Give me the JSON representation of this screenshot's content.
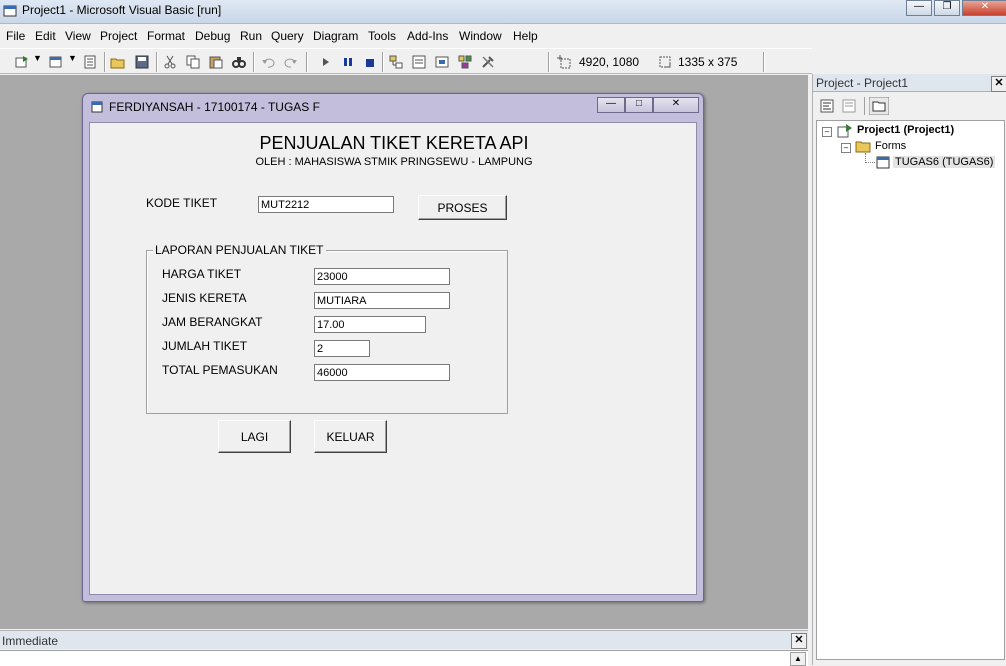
{
  "window": {
    "title": "Project1 - Microsoft Visual Basic [run]"
  },
  "menu": [
    "File",
    "Edit",
    "View",
    "Project",
    "Format",
    "Debug",
    "Run",
    "Query",
    "Diagram",
    "Tools",
    "Add-Ins",
    "Window",
    "Help"
  ],
  "toolbar": {
    "position": "4920, 1080",
    "size": "1335 x 375"
  },
  "form": {
    "title": "FERDIYANSAH - 17100174 - TUGAS F",
    "heading": "PENJUALAN TIKET KERETA API",
    "subheading": "OLEH : MAHASISWA STMIK PRINGSEWU - LAMPUNG",
    "kode_label": "KODE TIKET",
    "kode_value": "MUT2212",
    "proses_label": "PROSES",
    "frame_caption": "LAPORAN PENJUALAN TIKET",
    "fields": [
      {
        "label": "HARGA TIKET",
        "value": "23000"
      },
      {
        "label": "JENIS KERETA",
        "value": "MUTIARA"
      },
      {
        "label": "JAM BERANGKAT",
        "value": "17.00"
      },
      {
        "label": "JUMLAH TIKET",
        "value": "2"
      },
      {
        "label": "TOTAL PEMASUKAN",
        "value": "46000"
      }
    ],
    "lagi_label": "LAGI",
    "keluar_label": "KELUAR"
  },
  "project": {
    "title": "Project - Project1",
    "root": "Project1 (Project1)",
    "folder": "Forms",
    "item": "TUGAS6 (TUGAS6)"
  },
  "immediate": {
    "title": "Immediate"
  }
}
